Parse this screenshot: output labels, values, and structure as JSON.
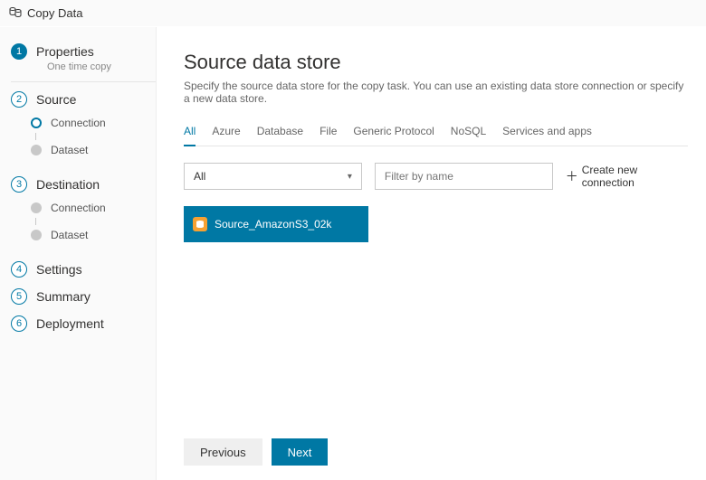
{
  "app": {
    "title": "Copy Data"
  },
  "sidebar": {
    "steps": [
      {
        "num": "1",
        "label": "Properties",
        "sub": "One time copy"
      },
      {
        "num": "2",
        "label": "Source",
        "children": [
          {
            "label": "Connection"
          },
          {
            "label": "Dataset"
          }
        ]
      },
      {
        "num": "3",
        "label": "Destination",
        "children": [
          {
            "label": "Connection"
          },
          {
            "label": "Dataset"
          }
        ]
      },
      {
        "num": "4",
        "label": "Settings"
      },
      {
        "num": "5",
        "label": "Summary"
      },
      {
        "num": "6",
        "label": "Deployment"
      }
    ]
  },
  "main": {
    "title": "Source data store",
    "description": "Specify the source data store for the copy task. You can use an existing data store connection or specify a new data store.",
    "tabs": [
      "All",
      "Azure",
      "Database",
      "File",
      "Generic Protocol",
      "NoSQL",
      "Services and apps"
    ],
    "filter_select": "All",
    "filter_placeholder": "Filter by name",
    "create_label": "Create new connection",
    "card": {
      "name": "Source_AmazonS3_02k"
    },
    "buttons": {
      "previous": "Previous",
      "next": "Next"
    }
  }
}
